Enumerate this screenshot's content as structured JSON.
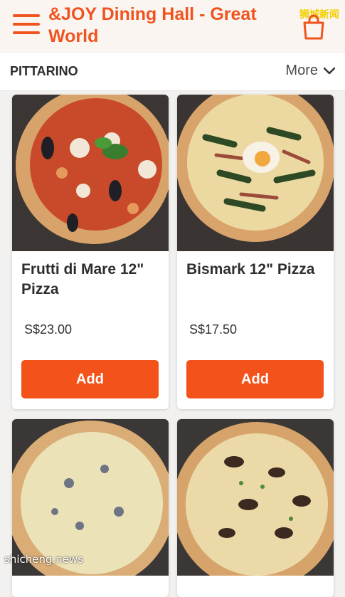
{
  "header": {
    "title": "&JOY Dining Hall - Great World",
    "watermark": "狮城新闻",
    "menu_icon": "hamburger-menu-icon",
    "cart_icon": "shopping-bag-icon"
  },
  "subheader": {
    "restaurant": "PITTARINO",
    "more_label": "More"
  },
  "products": [
    {
      "name": "Frutti di Mare 12\" Pizza",
      "price": "S$23.00",
      "add_label": "Add"
    },
    {
      "name": "Bismark 12\" Pizza",
      "price": "S$17.50",
      "add_label": "Add"
    },
    {
      "name": "",
      "price": "",
      "add_label": ""
    },
    {
      "name": "",
      "price": "",
      "add_label": ""
    }
  ],
  "footer": {
    "watermark": "shicheng.news"
  },
  "colors": {
    "accent": "#f0541e",
    "button": "#f3531b",
    "header_bg": "#fbf5f2"
  }
}
